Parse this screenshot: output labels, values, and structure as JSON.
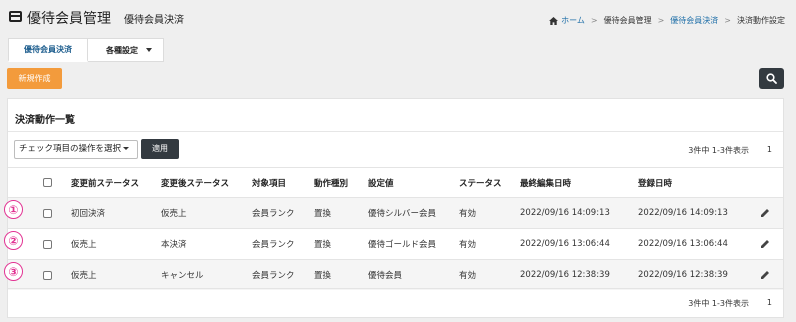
{
  "header": {
    "title": "優待会員管理",
    "subtitle": "優待会員決済",
    "icon": "card-icon"
  },
  "breadcrumb": {
    "home": "ホーム",
    "items": [
      "優待会員管理",
      "優待会員決済",
      "決済動作設定"
    ]
  },
  "tabs": [
    {
      "label": "優待会員決済",
      "active": true
    },
    {
      "label": "各種設定",
      "dropdown": true
    }
  ],
  "toolbar": {
    "new_label": "新規作成",
    "search_icon": "search-icon"
  },
  "panel": {
    "title": "決済動作一覧",
    "bulk_select_value": "チェック項目の操作を選択",
    "apply_label": "適用",
    "count_text": "3件中 1-3件表示",
    "page": "1"
  },
  "table": {
    "columns": [
      "変更前ステータス",
      "変更後ステータス",
      "対象項目",
      "動作種別",
      "設定値",
      "ステータス",
      "最終編集日時",
      "登録日時"
    ],
    "rows": [
      {
        "marker": "①",
        "before": "初回決済",
        "after": "仮売上",
        "item": "会員ランク",
        "type": "置換",
        "setting": "優待シルバー会員",
        "status": "有効",
        "updated": "2022/09/16 14:09:13",
        "created": "2022/09/16 14:09:13"
      },
      {
        "marker": "②",
        "before": "仮売上",
        "after": "本決済",
        "item": "会員ランク",
        "type": "置換",
        "setting": "優待ゴールド会員",
        "status": "有効",
        "updated": "2022/09/16 13:06:44",
        "created": "2022/09/16 13:06:44"
      },
      {
        "marker": "③",
        "before": "仮売上",
        "after": "キャンセル",
        "item": "会員ランク",
        "type": "置換",
        "setting": "優待会員",
        "status": "有効",
        "updated": "2022/09/16 12:38:39",
        "created": "2022/09/16 12:38:39"
      }
    ]
  },
  "colors": {
    "accent_orange": "#f39b3c",
    "dark_button": "#333a40",
    "link_blue": "#1f6fa8",
    "marker_pink": "#e23393"
  }
}
